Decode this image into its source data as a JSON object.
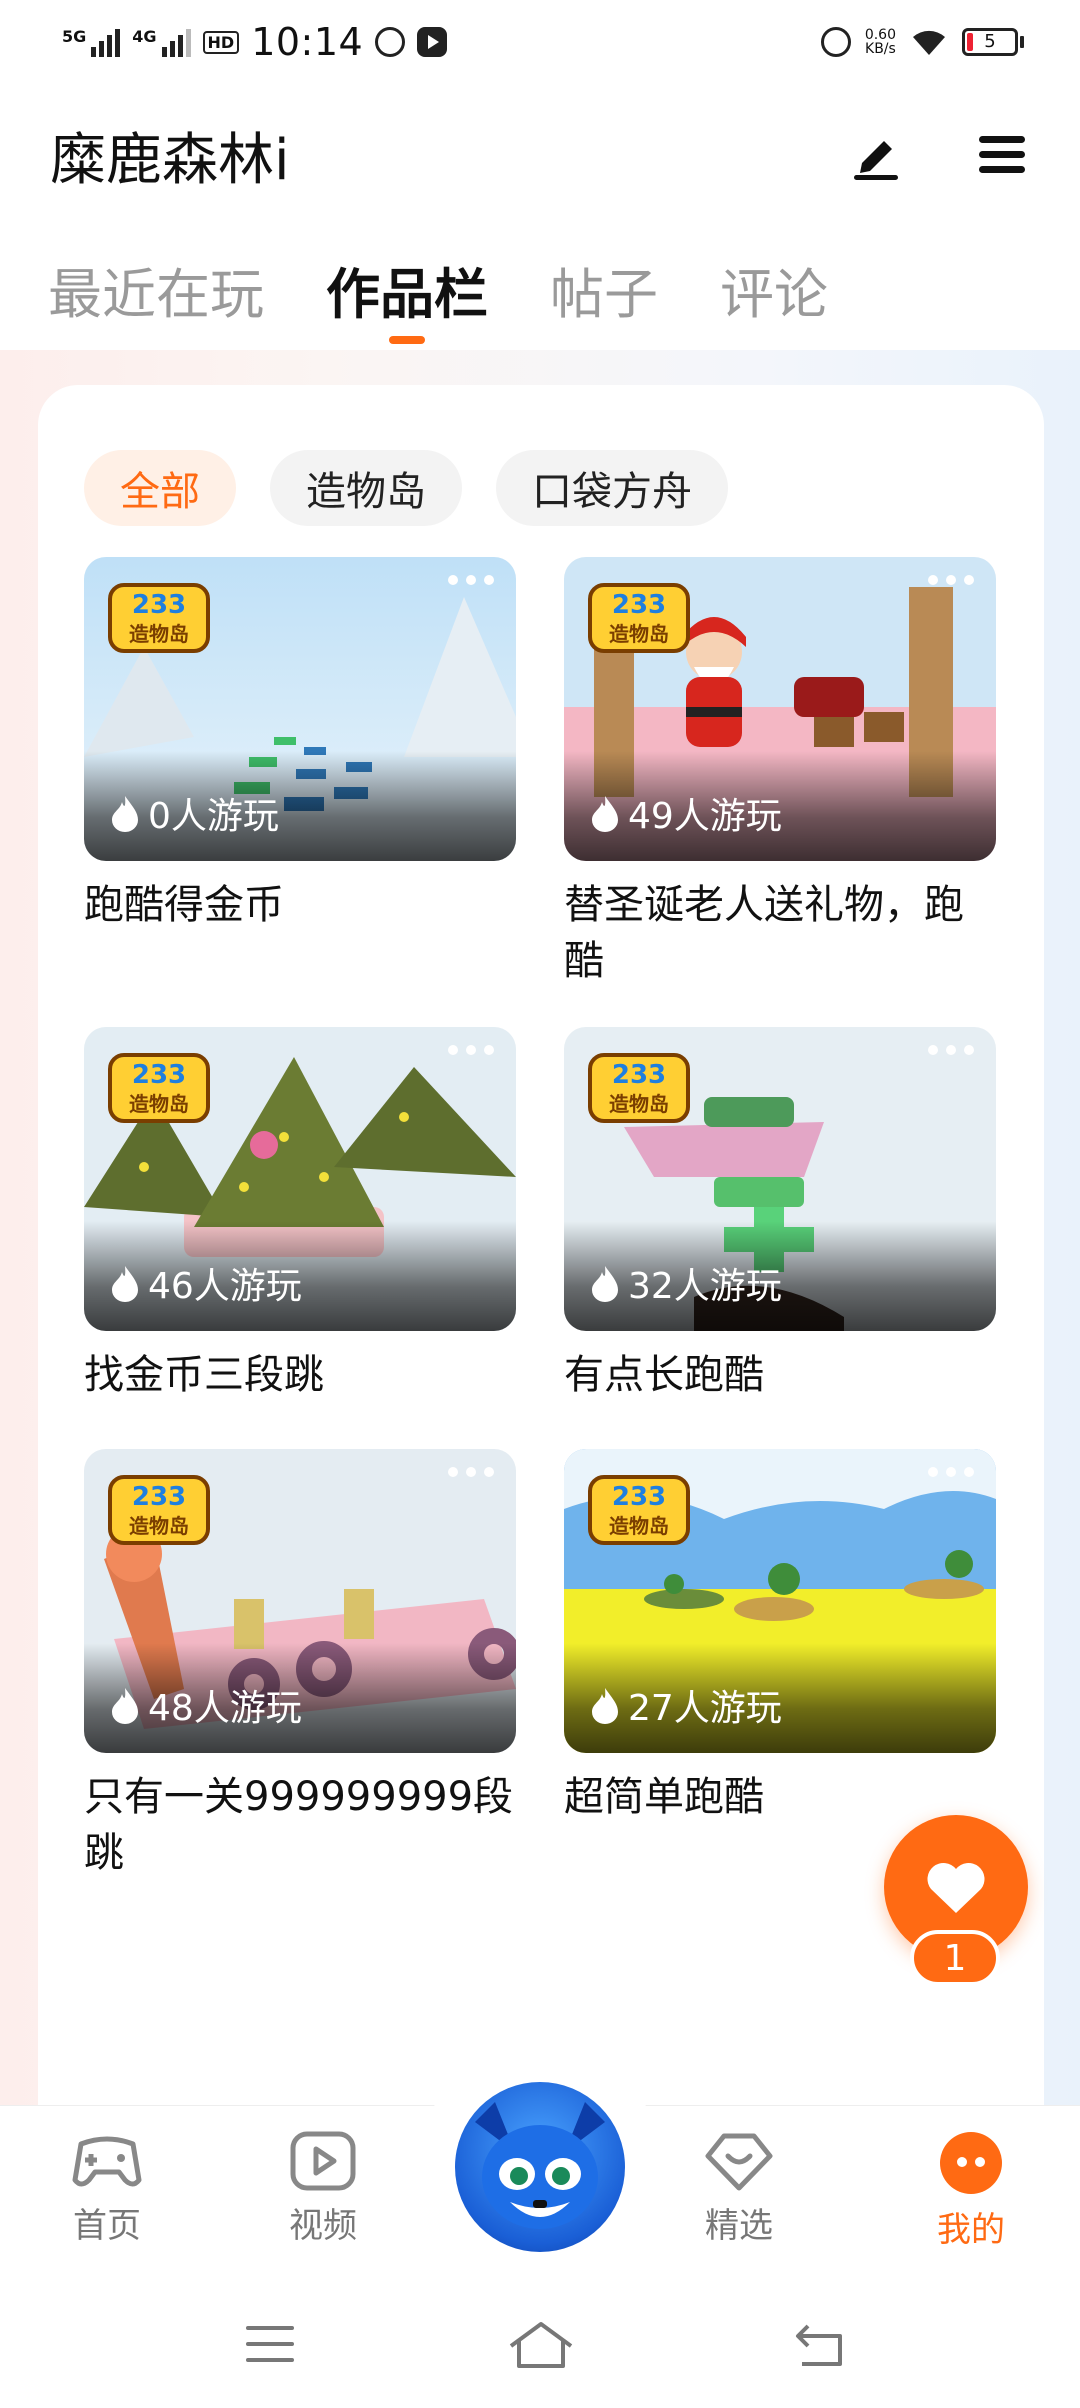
{
  "status_bar": {
    "net1": "5G",
    "net2": "4G",
    "hd": "HD",
    "time": "10:14",
    "speed_value": "0.60",
    "speed_unit": "KB/s",
    "battery": "5"
  },
  "header": {
    "profile_name": "糜鹿森林i",
    "edit_icon": "pen-icon",
    "menu_icon": "hamburger-icon"
  },
  "tabs": [
    {
      "label": "最近在玩",
      "active": false
    },
    {
      "label": "作品栏",
      "active": true
    },
    {
      "label": "帖子",
      "active": false
    },
    {
      "label": "评论",
      "active": false
    }
  ],
  "filters": [
    {
      "label": "全部",
      "active": true
    },
    {
      "label": "造物岛",
      "active": false
    },
    {
      "label": "口袋方舟",
      "active": false
    }
  ],
  "games": [
    {
      "title": "跑酷得金币",
      "plays": "0人游玩"
    },
    {
      "title": "替圣诞老人送礼物，跑酷",
      "plays": "49人游玩"
    },
    {
      "title": "找金币三段跳",
      "plays": "46人游玩"
    },
    {
      "title": "有点长跑酷",
      "plays": "32人游玩"
    },
    {
      "title": "只有一关999999999段跳",
      "plays": "48人游玩"
    },
    {
      "title": "超简单跑酷",
      "plays": "27人游玩"
    }
  ],
  "badge_text": {
    "num": "233",
    "name": "造物岛"
  },
  "like": {
    "count": "1"
  },
  "bottom_nav": [
    {
      "label": "首页",
      "icon": "gamepad-icon"
    },
    {
      "label": "视频",
      "icon": "video-icon"
    },
    {
      "label": "精选",
      "icon": "heart-chat-icon"
    },
    {
      "label": "我的",
      "icon": "face-icon",
      "active": true
    }
  ],
  "colors": {
    "accent": "#ff6a13",
    "inactive_text": "#9a9a9a"
  }
}
